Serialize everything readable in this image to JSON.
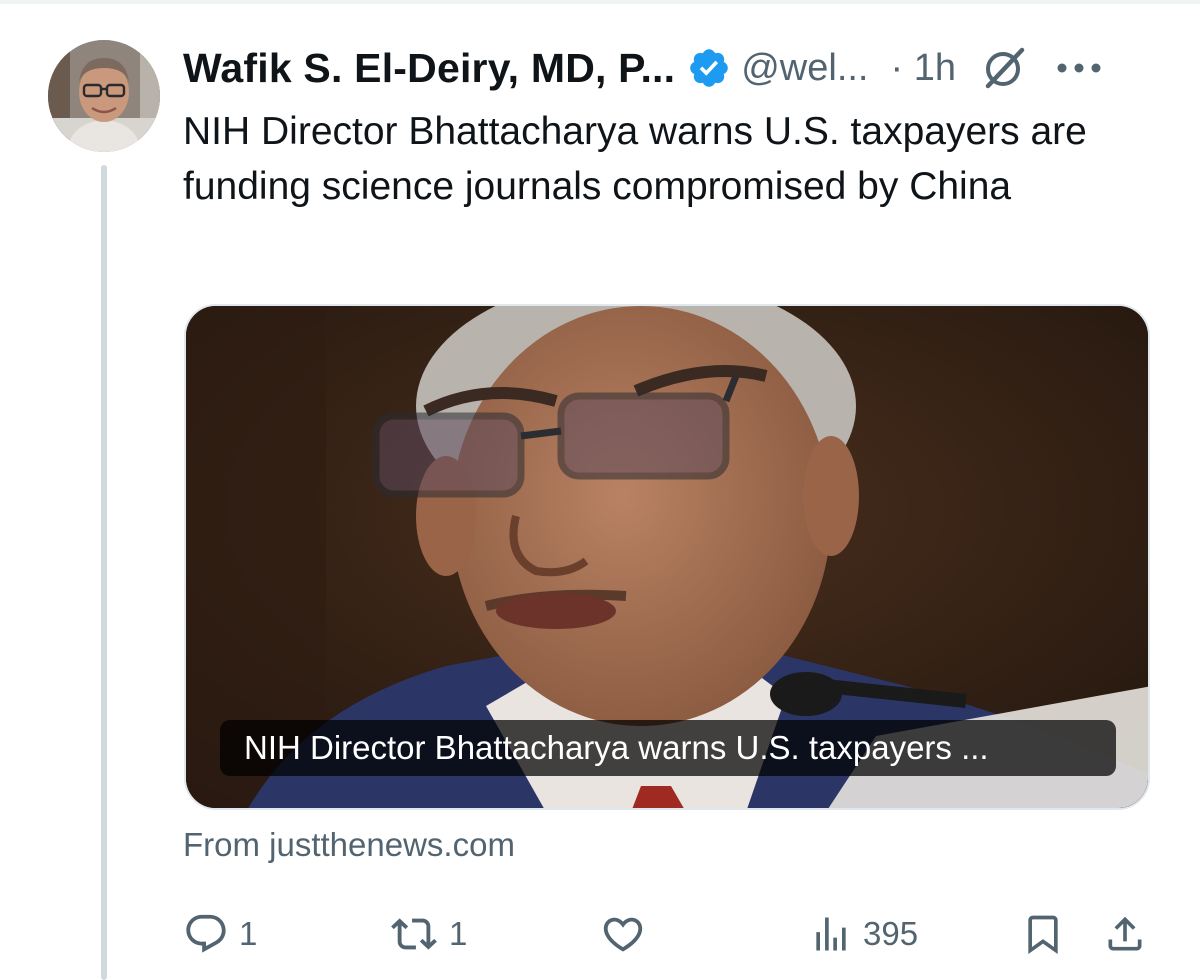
{
  "post": {
    "author_name": "Wafik S. El-Deiry, MD, P...",
    "handle": "@wel...",
    "time": "· 1h",
    "text": "NIH Director Bhattacharya warns U.S. taxpayers are funding science journals compromised by China",
    "card": {
      "caption": "NIH Director Bhattacharya warns U.S. taxpayers ...",
      "source": "From justthenews.com"
    },
    "actions": {
      "replies": "1",
      "reposts": "1",
      "likes": "",
      "views": "395"
    }
  },
  "colors": {
    "text": "#0f1419",
    "secondary": "#536471",
    "verified": "#1d9bf0",
    "thread_line": "#cfd9de"
  },
  "icons": [
    "verified-badge-icon",
    "grok-icon",
    "more-icon",
    "reply-icon",
    "repost-icon",
    "like-icon",
    "views-icon",
    "bookmark-icon",
    "share-icon"
  ]
}
